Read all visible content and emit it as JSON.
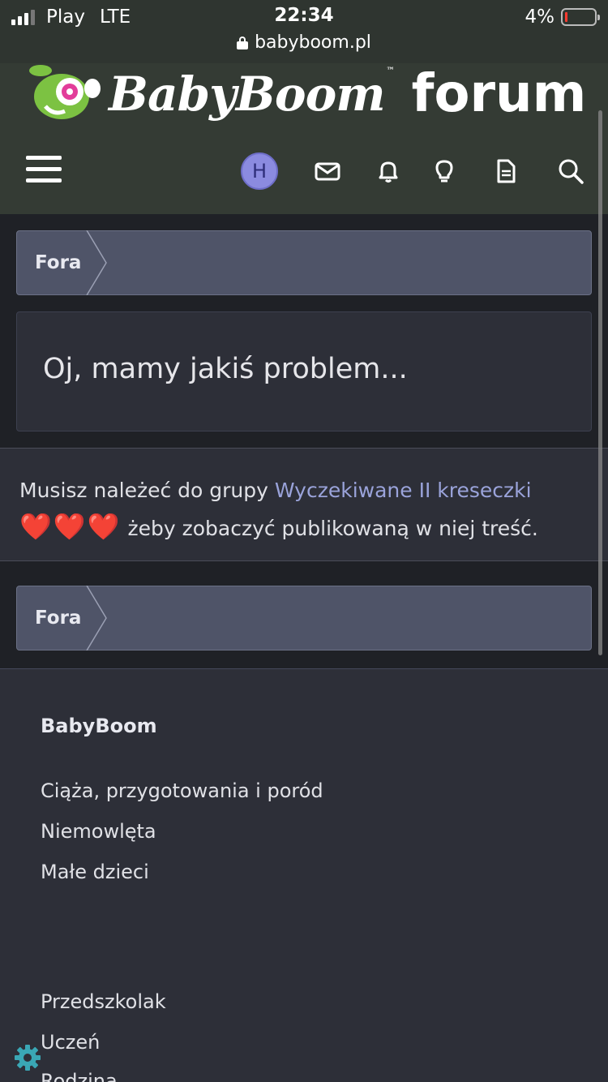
{
  "status_bar": {
    "carrier": "Play",
    "network": "LTE",
    "time": "22:34",
    "battery": "4%",
    "url": "babyboom.pl"
  },
  "header": {
    "logo_text": "BabyBoom",
    "logo_tm": "™",
    "logo_forum": "forum",
    "avatar_letter": "H",
    "icons": [
      "menu-icon",
      "mail-icon",
      "bell-icon",
      "lightbulb-icon",
      "document-icon",
      "search-icon"
    ]
  },
  "breadcrumb": {
    "label": "Fora"
  },
  "error": {
    "title": "Oj, mamy jakiś problem..."
  },
  "notice": {
    "text_before": "Musisz należeć do grupy ",
    "group_link": "Wyczekiwane II kreseczki",
    "hearts": "❤️❤️❤️",
    "text_after": " żeby zobaczyć publikowaną w niej treść."
  },
  "footer": {
    "heading": "BabyBoom",
    "links": [
      "Ciąża, przygotowania i poród",
      "Niemowlęta",
      "Małe dzieci",
      "Przedszkolak",
      "Uczeń",
      "Rodzina"
    ]
  },
  "colors": {
    "header_bg": "#343b34",
    "breadcrumb_bg": "#4f5468",
    "link": "#9aa3da",
    "avatar_bg": "#8b8be0",
    "accent_gear": "#3aa7b5"
  }
}
